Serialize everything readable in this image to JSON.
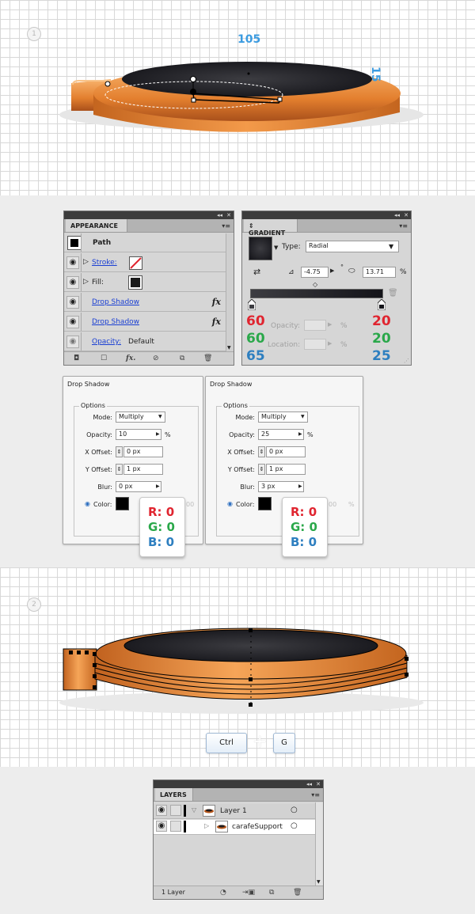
{
  "step1": {
    "number": "1",
    "dimension_width": "105",
    "dimension_height": "15"
  },
  "appearance_panel": {
    "tab_label": "APPEARANCE",
    "header": "Path",
    "rows": [
      {
        "label": "Stroke:",
        "swatch": "none"
      },
      {
        "label": "Fill:",
        "swatch": "#1a1a1a"
      },
      {
        "label": "Drop Shadow",
        "fx": "fx"
      },
      {
        "label": "Drop Shadow",
        "fx": "fx"
      },
      {
        "label": "Opacity:",
        "value": "Default"
      }
    ]
  },
  "gradient_panel": {
    "tab_label": "GRADIENT",
    "type_label": "Type:",
    "type_value": "Radial",
    "angle_value": "-4.75",
    "degree_symbol": "°",
    "aspect_value": "13.71",
    "aspect_unit": "%",
    "opacity_label": "Opacity:",
    "location_label": "Location:",
    "percent": "%",
    "left_rgb": [
      "60",
      "60",
      "65"
    ],
    "right_rgb": [
      "20",
      "20",
      "25"
    ]
  },
  "drop_shadows": [
    {
      "title": "Drop Shadow",
      "options_label": "Options",
      "mode_label": "Mode:",
      "mode_value": "Multiply",
      "opacity_label": "Opacity:",
      "opacity_value": "10",
      "opacity_unit": "%",
      "xoffset_label": "X Offset:",
      "xoffset_value": "0 px",
      "yoffset_label": "Y Offset:",
      "yoffset_value": "1 px",
      "blur_label": "Blur:",
      "blur_value": "0 px",
      "color_label": "Color:",
      "faded_value": "00",
      "faded_percent": "%",
      "rgb": {
        "r": "R: 0",
        "g": "G: 0",
        "b": "B: 0"
      }
    },
    {
      "title": "Drop Shadow",
      "options_label": "Options",
      "mode_label": "Mode:",
      "mode_value": "Multiply",
      "opacity_label": "Opacity:",
      "opacity_value": "25",
      "opacity_unit": "%",
      "xoffset_label": "X Offset:",
      "xoffset_value": "0 px",
      "yoffset_label": "Y Offset:",
      "yoffset_value": "1 px",
      "blur_label": "Blur:",
      "blur_value": "3 px",
      "color_label": "Color:",
      "faded_value": "00",
      "faded_percent": "%",
      "rgb": {
        "r": "R: 0",
        "g": "G: 0",
        "b": "B: 0"
      }
    }
  ],
  "step2": {
    "number": "2",
    "shortcut_key1": "Ctrl",
    "shortcut_key2": "G"
  },
  "layers_panel": {
    "tab_label": "LAYERS",
    "layer_name": "Layer 1",
    "sublayer_name": "carafeSupport",
    "footer": "1 Layer"
  },
  "colors": {
    "red": "#e02530",
    "green": "#2aa84a",
    "blue": "#2e7fc0",
    "dimension_blue": "#3b9be0",
    "orange_light": "#f7a55c",
    "orange_dark": "#b3541a"
  }
}
